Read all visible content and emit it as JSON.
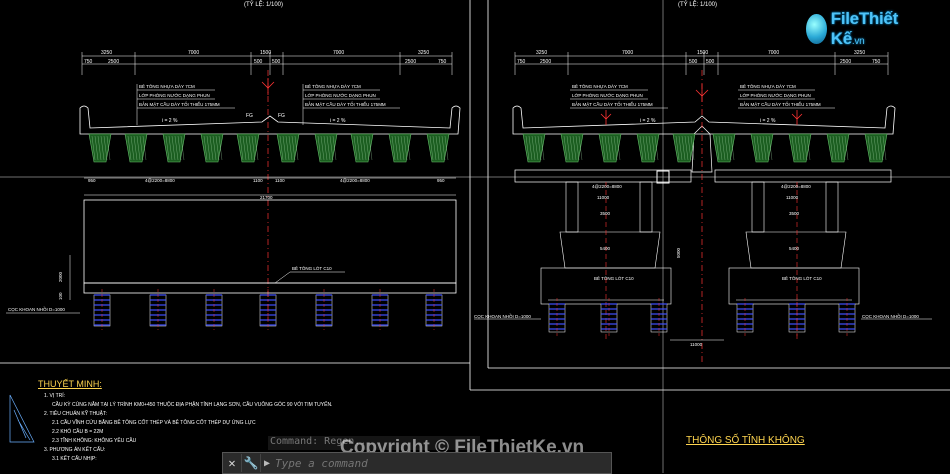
{
  "header": {
    "scale_left": "(TỶ LỆ: 1/100)",
    "scale_right": "(TỶ LỆ: 1/100)"
  },
  "logo": {
    "brand": "File",
    "brand2": "Thiết Kế",
    "tld": ".vn"
  },
  "left_section": {
    "dims_top": [
      "3250",
      "7000",
      "1500",
      "7000",
      "3250"
    ],
    "dims_sub": [
      "750",
      "2500",
      "500",
      "500",
      "2500",
      "750"
    ],
    "note1_lines": [
      "BÊ TÔNG NHỰA DÀY 7CM",
      "LỚP PHÒNG NƯỚC DẠNG PHUN",
      "BẢN MẶT CẦU DÀY TỐI THIỂU 175MM"
    ],
    "note2_lines": [
      "BÊ TÔNG NHỰA DÀY 7CM",
      "LỚP PHÒNG NƯỚC DẠNG PHUN",
      "BẢN MẶT CẦU DÀY TỐI THIỂU 175MM"
    ],
    "slope_left": "i = 2 %",
    "slope_right": "i = 2 %",
    "fg": "FG",
    "dims_bottom": [
      "950",
      "4@2200=8800",
      "1100",
      "1100",
      "4@2200=8800",
      "950"
    ],
    "total_width": "21700",
    "lean_label": "BÊ TÔNG LÓT C10",
    "pile_label": "CỌC KHOAN NHỒI D=1000",
    "h_dims": [
      "2000",
      "100"
    ]
  },
  "right_section": {
    "dims_top": [
      "3250",
      "7000",
      "1500",
      "7000",
      "3250"
    ],
    "dims_sub": [
      "750",
      "2500",
      "500",
      "500",
      "2500",
      "750"
    ],
    "note1_lines": [
      "BÊ TÔNG NHỰA DÀY 7CM",
      "LỚP PHÒNG NƯỚC DẠNG PHUN",
      "BẢN MẶT CẦU DÀY TỐI THIỂU 175MM"
    ],
    "note2_lines": [
      "BÊ TÔNG NHỰA DÀY 7CM",
      "LỚP PHÒNG NƯỚC DẠNG PHUN",
      "BẢN MẶT CẦU DÀY TỐI THIỂU 175MM"
    ],
    "slope": "i = 2 %",
    "pier_dims": [
      "4@2200=8800",
      "11000",
      "3500",
      "5400",
      "1800"
    ],
    "lean_label": "BÊ TÔNG LÓT C10",
    "pile_label_left": "CỌC KHOAN NHỒI D=1000",
    "pile_label_right": "CỌC KHOAN NHỒI D=1000",
    "elev_dim": "5000",
    "pile_dim": "11000"
  },
  "notes": {
    "title": "THUYẾT MINH:",
    "lines": [
      "1. VỊ TRÍ:",
      "CẦU KỲ CÙNG NẰM TẠI LÝ TRÌNH KM0+450 THUỘC ĐỊA PHẬN TỈNH LẠNG SƠN, CẦU VUÔNG GÓC 90 VỚI TIM TUYẾN.",
      "2. TIÊU CHUẨN KỸ THUẬT:",
      "2.1 CẦU VĨNH CỬU BẰNG BÊ TÔNG CỐT THÉP VÀ BÊ TÔNG CỐT THÉP DỰ ỨNG LỰC",
      "2.2 KHỔ CẦU B = 22M",
      "2.3 TĨNH KHÔNG: KHÔNG YÊU CẦU",
      "3. PHƯƠNG ÁN KẾT CẤU:",
      "3.1 KẾT CẤU NHỊP:"
    ]
  },
  "params_title": "THÔNG SỐ TĨNH KHÔNG",
  "command": {
    "history": "Command: Regen...",
    "placeholder": "Type a command",
    "close_glyph": "✕",
    "settings_glyph": "🔧",
    "prompt_glyph": "▶"
  },
  "watermark": "Copyright © FileThietKe.vn",
  "colors": {
    "background": "#000000",
    "frame": "#ffffff",
    "dimension": "#ffffff",
    "girder_fill": "#2e7d32",
    "centerline": "#ff3333",
    "pile": "#3f51ff",
    "accent_text": "#ffd54f"
  }
}
